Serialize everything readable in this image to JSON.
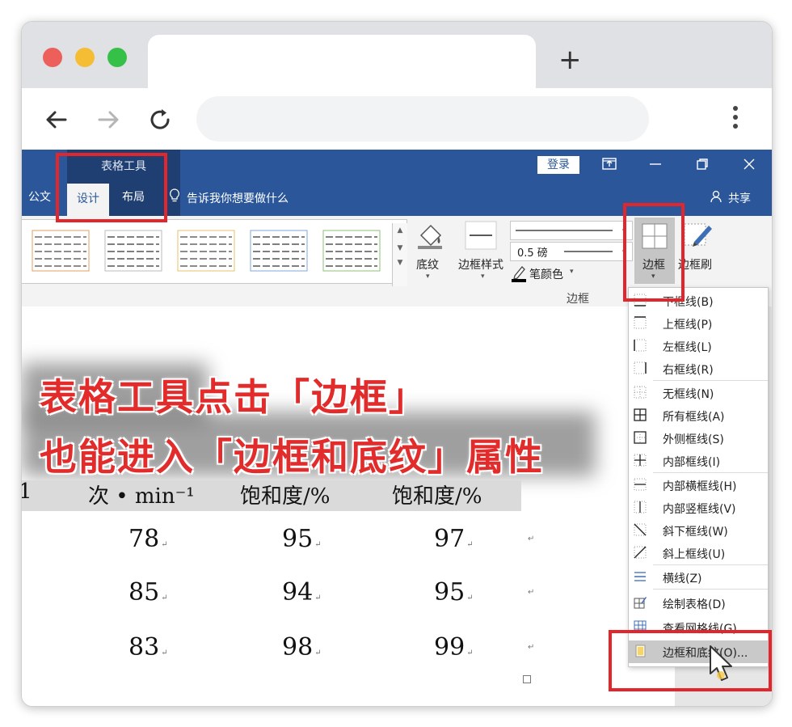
{
  "browser": {
    "new_tab_symbol": "+",
    "traffic_lights": [
      "#ec5f5b",
      "#f5bd33",
      "#35c048"
    ]
  },
  "word": {
    "context_group": "表格工具",
    "login": "登录",
    "tabs": {
      "left_partial": "公文",
      "design": "设计",
      "layout": "布局"
    },
    "tell_me": "告诉我你想要做什么",
    "share": "共享",
    "ribbon": {
      "shading": "底纹",
      "border_styles": "边框样式",
      "pen_weight": "0.5 磅",
      "pen_color": "笔颜色",
      "group_borders": "边框",
      "borders_button": "边框",
      "border_painter": "边框刷"
    }
  },
  "overlay": {
    "line1": "表格工具点击「边框」",
    "line2": "也能进入「边框和底纹」属性"
  },
  "table": {
    "header_partial": [
      "次 • min⁻¹",
      "饱和度/%",
      "饱和度/%"
    ],
    "header_left_fragment": "1",
    "rows": [
      [
        "78",
        "95",
        "97"
      ],
      [
        "85",
        "94",
        "95"
      ],
      [
        "83",
        "98",
        "99"
      ]
    ]
  },
  "dropdown": {
    "items": [
      {
        "label": "下框线(B)",
        "icon": "bottom-border-icon"
      },
      {
        "label": "上框线(P)",
        "icon": "top-border-icon"
      },
      {
        "label": "左框线(L)",
        "icon": "left-border-icon"
      },
      {
        "label": "右框线(R)",
        "icon": "right-border-icon"
      },
      {
        "label": "无框线(N)",
        "icon": "no-border-icon"
      },
      {
        "label": "所有框线(A)",
        "icon": "all-borders-icon"
      },
      {
        "label": "外侧框线(S)",
        "icon": "outside-borders-icon"
      },
      {
        "label": "内部框线(I)",
        "icon": "inside-borders-icon"
      },
      {
        "label": "内部横框线(H)",
        "icon": "inside-horizontal-border-icon"
      },
      {
        "label": "内部竖框线(V)",
        "icon": "inside-vertical-border-icon"
      },
      {
        "label": "斜下框线(W)",
        "icon": "diagonal-down-border-icon"
      },
      {
        "label": "斜上框线(U)",
        "icon": "diagonal-up-border-icon"
      },
      {
        "label": "横线(Z)",
        "icon": "horizontal-line-icon"
      },
      {
        "label": "绘制表格(D)",
        "icon": "draw-table-icon"
      },
      {
        "label": "查看网格线(G)",
        "icon": "view-gridlines-icon"
      },
      {
        "label": "边框和底纹(O)...",
        "icon": "borders-shading-icon"
      }
    ]
  },
  "colors": {
    "accent_red": "#e3262b",
    "word_blue": "#2b579a"
  }
}
